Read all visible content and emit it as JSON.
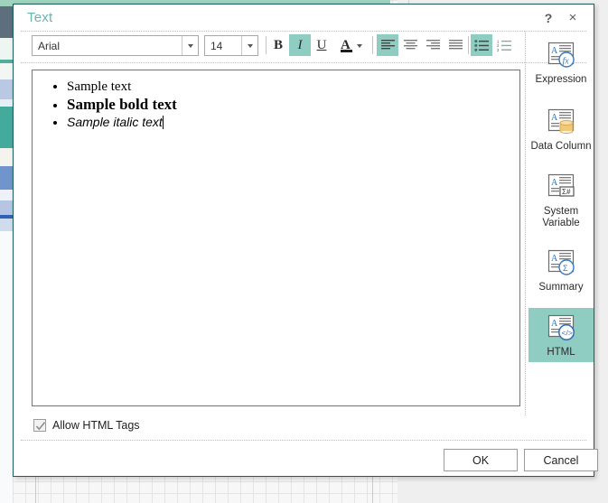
{
  "dialog": {
    "title": "Text",
    "help_icon": "?",
    "close_icon": "×"
  },
  "toolbar": {
    "font_family": {
      "value": "Arial",
      "icon": "chevron-down-icon"
    },
    "font_size": {
      "value": "14",
      "icon": "chevron-down-icon"
    },
    "bold_label": "B",
    "italic_label": "I",
    "underline_label": "U",
    "font_color_label": "A",
    "font_color_swatch": "#1d1d1d",
    "buttons": [
      {
        "name": "bold",
        "label": "B",
        "active": false
      },
      {
        "name": "italic",
        "label": "I",
        "active": true
      },
      {
        "name": "underline",
        "label": "U",
        "active": false
      }
    ],
    "align_buttons": [
      {
        "name": "align-left",
        "active": true
      },
      {
        "name": "align-center",
        "active": false
      },
      {
        "name": "align-right",
        "active": false
      },
      {
        "name": "align-justify",
        "active": false
      }
    ],
    "list_buttons": [
      {
        "name": "bulleted-list",
        "active": true
      },
      {
        "name": "numbered-list",
        "active": false
      }
    ]
  },
  "editor": {
    "lines": [
      {
        "text": "Sample text",
        "style": "regular"
      },
      {
        "text": "Sample bold text",
        "style": "bold"
      },
      {
        "text": "Sample italic text",
        "style": "italic"
      }
    ]
  },
  "rail": {
    "items": [
      {
        "label": "Expression",
        "icon": "expression-icon",
        "selected": false
      },
      {
        "label": "Data Column",
        "icon": "data-column-icon",
        "selected": false
      },
      {
        "label": "System Variable",
        "icon": "system-variable-icon",
        "selected": false
      },
      {
        "label": "Summary",
        "icon": "summary-icon",
        "selected": false
      },
      {
        "label": "HTML",
        "icon": "html-icon",
        "selected": true
      }
    ]
  },
  "footer": {
    "allow_html_label": "Allow HTML Tags",
    "allow_html_checked": true,
    "ok_label": "OK",
    "cancel_label": "Cancel"
  },
  "colors": {
    "accent": "#8fcdc2",
    "title_text": "#69b5ab",
    "dialog_border": "#1f5e5e",
    "editor_border": "#3f8d80"
  }
}
